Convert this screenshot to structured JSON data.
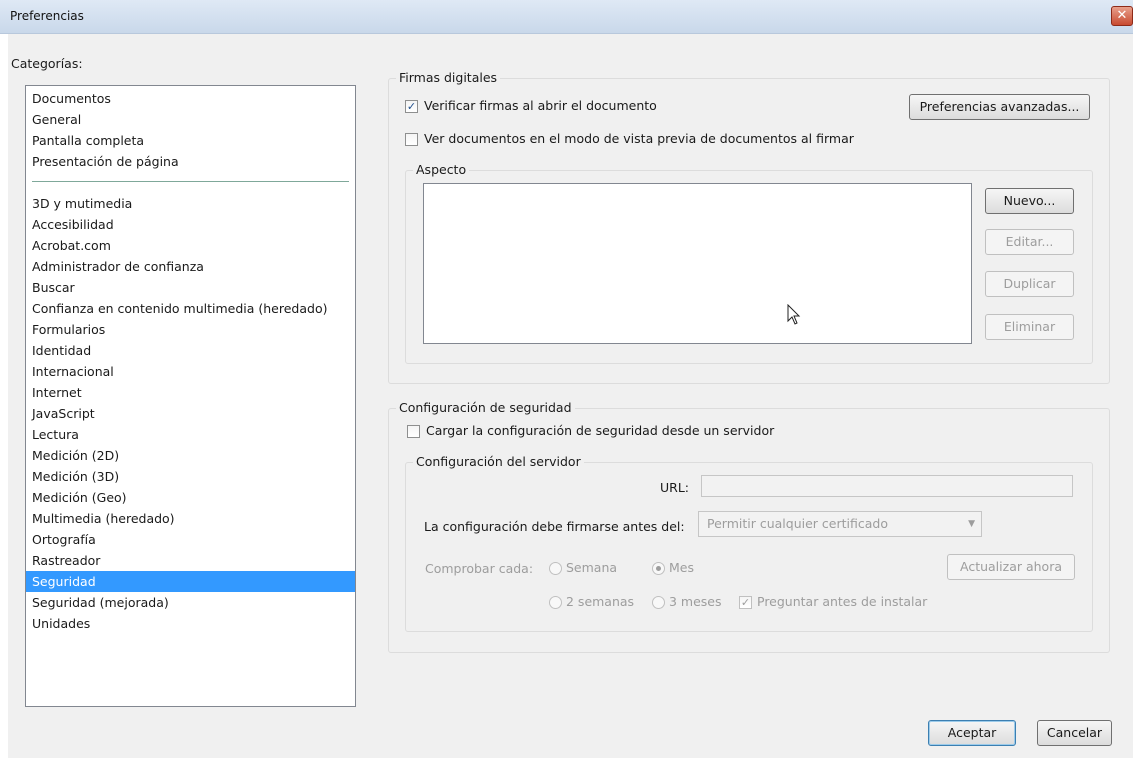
{
  "window": {
    "title": "Preferencias",
    "close_glyph": "✕"
  },
  "categories": {
    "label": "Categorías:",
    "group_top": [
      "Documentos",
      "General",
      "Pantalla completa",
      "Presentación de página"
    ],
    "group_bottom": [
      "3D y mutimedia",
      "Accesibilidad",
      "Acrobat.com",
      "Administrador de confianza",
      "Buscar",
      "Confianza en contenido multimedia (heredado)",
      "Formularios",
      "Identidad",
      "Internacional",
      "Internet",
      "JavaScript",
      "Lectura",
      "Medición (2D)",
      "Medición (3D)",
      "Medición (Geo)",
      "Multimedia (heredado)",
      "Ortografía",
      "Rastreador",
      "Seguridad",
      "Seguridad (mejorada)",
      "Unidades"
    ],
    "selected": "Seguridad"
  },
  "digital_signatures": {
    "title": "Firmas digitales",
    "verify_on_open": {
      "label": "Verificar firmas al abrir el documento",
      "checked": true,
      "glyph": "✓"
    },
    "preview_mode": {
      "label": "Ver documentos en el modo de vista previa de documentos al firmar",
      "checked": false
    },
    "advanced_button": "Preferencias avanzadas...",
    "appearance": {
      "title": "Aspecto",
      "new_button": "Nuevo...",
      "edit_button": "Editar...",
      "duplicate_button": "Duplicar",
      "delete_button": "Eliminar"
    }
  },
  "security_settings": {
    "title": "Configuración de seguridad",
    "load_from_server": {
      "label": "Cargar la configuración de seguridad desde un servidor",
      "checked": false
    },
    "server": {
      "title": "Configuración del servidor",
      "url_label": "URL:",
      "url_value": "",
      "sign_label": "La configuración debe firmarse antes del:",
      "sign_value": "Permitir cualquier certificado",
      "check_label": "Comprobar cada:",
      "options": {
        "week": "Semana",
        "month": "Mes",
        "two_weeks": "2 semanas",
        "three_months": "3 meses"
      },
      "selected_option": "Mes",
      "ask_before_install": {
        "label": "Preguntar antes de instalar",
        "checked": true,
        "glyph": "✓"
      },
      "update_now_button": "Actualizar ahora"
    }
  },
  "footer": {
    "ok_button": "Aceptar",
    "cancel_button": "Cancelar"
  },
  "colors": {
    "selection": "#3399ff",
    "dialog_bg": "#f0f0f0",
    "default_button_border": "#3c7fb1"
  },
  "icons": [
    "close-icon",
    "checkmark-icon",
    "dropdown-arrow-icon",
    "mouse-cursor-icon"
  ]
}
